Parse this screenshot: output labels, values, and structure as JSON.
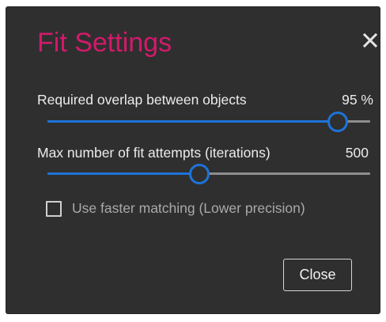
{
  "dialog": {
    "title": "Fit Settings",
    "close_icon": "close-icon",
    "title_color": "#d21a6b",
    "accent_color": "#1e73d8"
  },
  "settings": [
    {
      "label": "Required overlap between objects",
      "value_text": "95 %",
      "fraction": 0.9
    },
    {
      "label": "Max number of fit attempts (iterations)",
      "value_text": "500",
      "fraction": 0.47
    }
  ],
  "faster_matching": {
    "label": "Use faster matching (Lower precision)",
    "checked": false
  },
  "close_button": {
    "label": "Close"
  }
}
